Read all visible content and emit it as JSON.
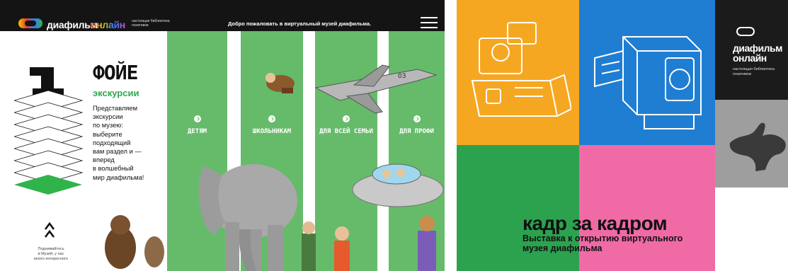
{
  "left_panel": {
    "header": {
      "logo_word": "диафильм",
      "logo_online": "онлайн",
      "logo_tagline": "настоящая библиотека позитивов",
      "welcome": "Добро пожаловать в виртуальный музей диафильма.",
      "menu_icon": "hamburger-menu-icon"
    },
    "floor_number": "1",
    "title": "ФОЙЕ",
    "subtitle": "экскурсии",
    "intro_lines": [
      "Представляем",
      "экскурсии",
      "по музею:",
      "выберите",
      "подходящий",
      "вам раздел и —",
      "вперед",
      "в волшебный",
      "мир диафильма!"
    ],
    "stripes": [
      {
        "label": "ДЕТЯМ"
      },
      {
        "label": "ШКОЛЬНИКАМ"
      },
      {
        "label": "ДЛЯ ВСЕЙ СЕМЬИ"
      },
      {
        "label": "ДЛЯ ПРОФИ"
      }
    ],
    "up_text_lines": [
      "Поднимайтесь",
      "в Музей, у нас",
      "много интересного"
    ],
    "jet_number": "03",
    "colors": {
      "green": "#66bb6a",
      "header": "#141414",
      "accent_text": "#2fa84f"
    }
  },
  "right_panel": {
    "logo_word": "диафильм",
    "logo_online": "онлайн",
    "logo_tagline": "настоящая библиотека позитивов",
    "exhibition_title": "кадр за кадром",
    "exhibition_subtitle": "Выставка к открытию виртуального музея диафильма",
    "colors": {
      "orange": "#f6a721",
      "blue": "#1f7ed2",
      "black": "#1b1b1b",
      "gray": "#9e9e9e",
      "green": "#2ca24f",
      "pink": "#f06aa6"
    }
  }
}
